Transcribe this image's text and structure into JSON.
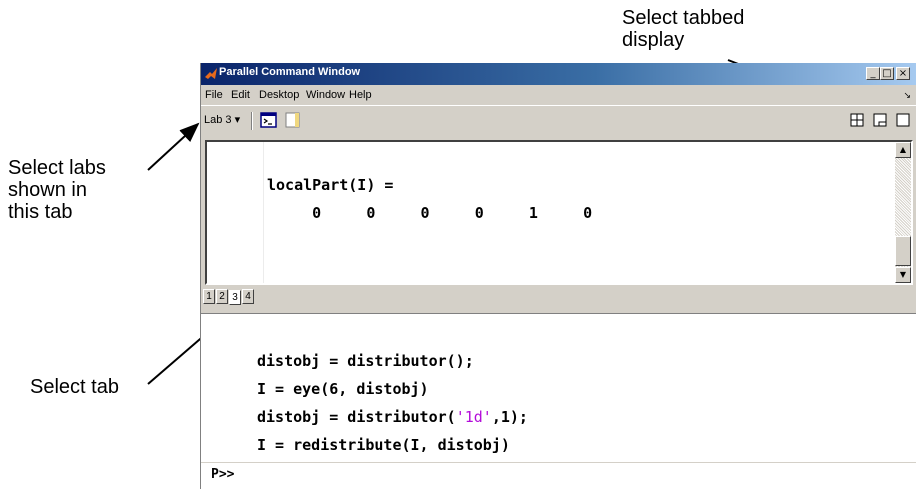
{
  "callouts": {
    "tabbed_display": [
      "Select tabbed",
      "display"
    ],
    "select_labs": [
      "Select labs",
      "shown in",
      "this tab"
    ],
    "select_tab": "Select tab"
  },
  "window": {
    "title": "Parallel Command Window",
    "controls": {
      "minimize": "_",
      "restore": "□",
      "close": "×"
    }
  },
  "menubar": {
    "items": [
      "File",
      "Edit",
      "Desktop",
      "Window",
      "Help"
    ],
    "undock": "↘"
  },
  "toolbar": {
    "lab_selector": "Lab 3 ▾",
    "icons": [
      "command-window-icon",
      "blank-document-icon"
    ],
    "layout_icons": [
      "grid-display-icon",
      "tabbed-display-icon",
      "single-display-icon"
    ]
  },
  "lab_output": {
    "var_line": "localPart(I) =",
    "values_line": "     0     0     0     0     1     0"
  },
  "tabs": [
    "1",
    "2",
    "3",
    "4"
  ],
  "active_tab": "3",
  "command": {
    "lines": [
      {
        "code": "distobj = distributor();"
      },
      {
        "code": "I = eye(6, distobj)"
      },
      {
        "pre": "distobj = distributor(",
        "str": "'1d'",
        "post": ",1);"
      },
      {
        "code": "I = redistribute(I, distobj)"
      }
    ],
    "prompt": "P>>"
  },
  "colors": {
    "titlebar_start": "#0a246a",
    "titlebar_end": "#a6caf0",
    "string_literal": "#b30cd9",
    "chrome": "#d4d0c8"
  }
}
